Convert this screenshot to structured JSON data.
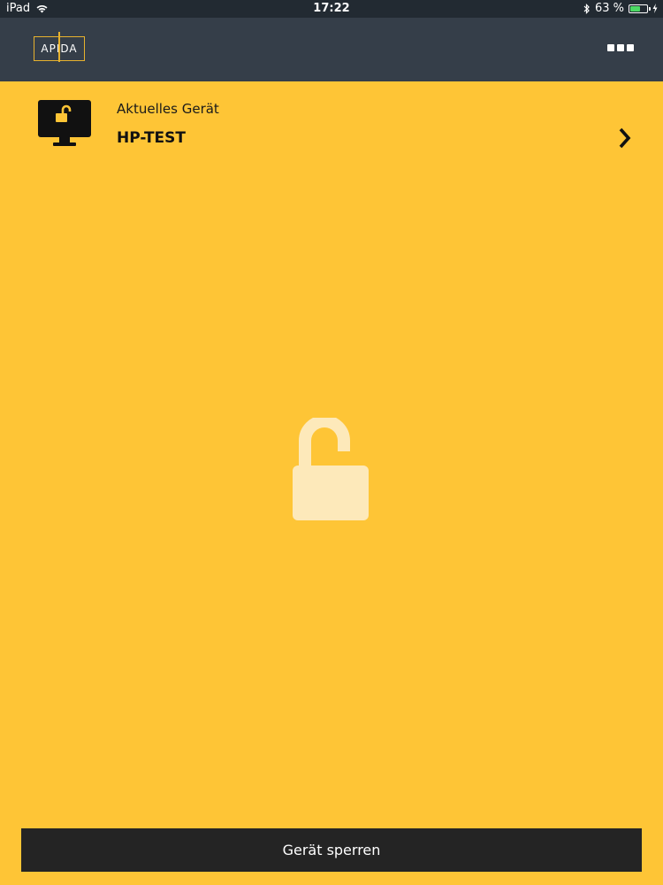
{
  "status_bar": {
    "device": "iPad",
    "time": "17:22",
    "battery_percent": "63 %",
    "battery_level": 0.63
  },
  "header": {
    "logo_text": "APIDA",
    "menu_icon": "more-dots-icon"
  },
  "device": {
    "label": "Aktuelles Gerät",
    "name": "HP-TEST",
    "icon": "monitor-unlocked-icon"
  },
  "main": {
    "status_icon": "unlocked-padlock-icon"
  },
  "footer": {
    "lock_button_label": "Gerät sperren"
  },
  "colors": {
    "background": "#FEC536",
    "header": "#353E49",
    "button": "#242424",
    "logo_accent": "#E7B22E"
  }
}
